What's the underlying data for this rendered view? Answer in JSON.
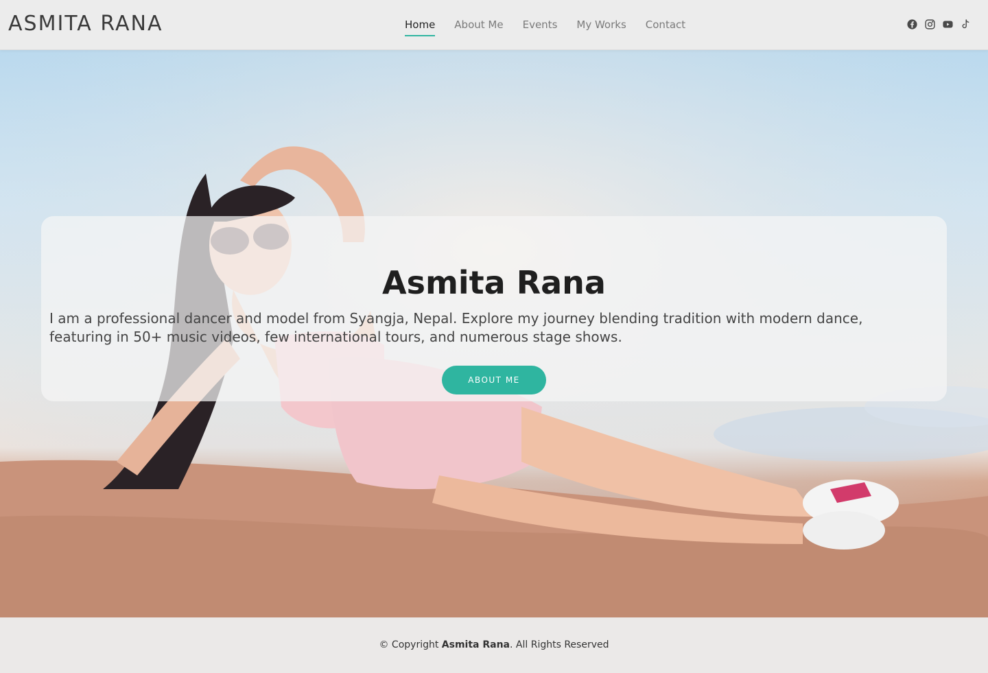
{
  "header": {
    "logo": "ASMITA RANA",
    "nav": [
      {
        "label": "Home",
        "active": true
      },
      {
        "label": "About Me",
        "active": false
      },
      {
        "label": "Events",
        "active": false
      },
      {
        "label": "My Works",
        "active": false
      },
      {
        "label": "Contact",
        "active": false
      }
    ],
    "socials": [
      "facebook-icon",
      "instagram-icon",
      "youtube-icon",
      "tiktok-icon"
    ]
  },
  "hero": {
    "title": "Asmita Rana",
    "description": "I am a professional dancer and model from Syangja, Nepal. Explore my journey blending tradition with modern dance, featuring in 50+ music videos, few international tours, and numerous stage shows.",
    "button_label": "ABOUT ME"
  },
  "footer": {
    "prefix": "© Copyright ",
    "name": "Asmita Rana",
    "suffix": ". All Rights Reserved"
  },
  "colors": {
    "accent": "#2fb5a0",
    "header_bg": "#ececec",
    "footer_bg": "#ebe9e8"
  }
}
